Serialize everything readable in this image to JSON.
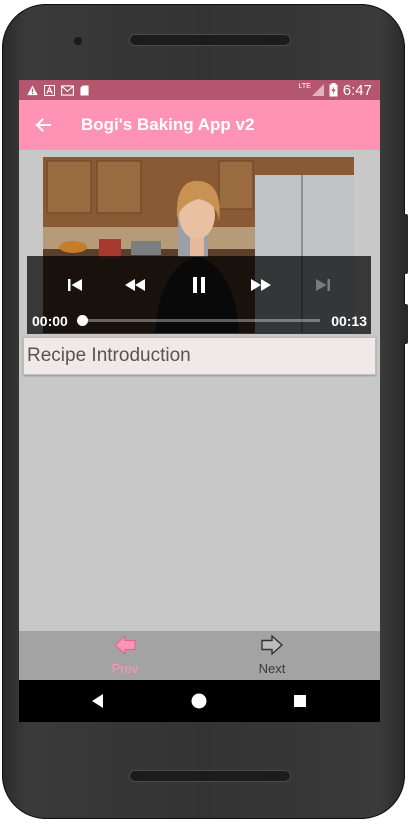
{
  "status_bar": {
    "network": "LTE",
    "time": "6:47",
    "icons": [
      "warning-icon",
      "notification-a-icon",
      "gmail-icon",
      "sd-card-icon"
    ]
  },
  "app_bar": {
    "title": "Bogi's Baking App v2",
    "back_icon": "arrow-back-icon"
  },
  "player": {
    "current_time": "00:00",
    "duration": "00:13",
    "progress": 0.0,
    "buttons": [
      "skip-previous-icon",
      "rewind-icon",
      "pause-icon",
      "fast-forward-icon",
      "skip-next-icon"
    ]
  },
  "step": {
    "title": "Recipe Introduction"
  },
  "bottom_nav": {
    "prev_label": "Prev",
    "next_label": "Next",
    "prev_color": "#ff93b5",
    "next_color": "#3a3a3a"
  },
  "colors": {
    "status_bar": "#b5566f",
    "app_bar": "#ff93b5",
    "screen_bg": "#c8c8c8",
    "card_bg": "#f1e8ea"
  }
}
